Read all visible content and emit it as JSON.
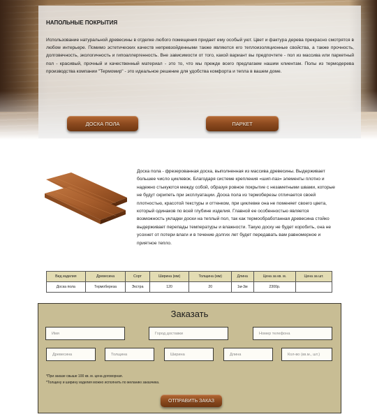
{
  "hero": {
    "title": "НАПОЛЬНЫЕ ПОКРЫТИЯ",
    "text": "Использование натуральной древесины в отделке любого помещения придает ему особый уют. Цвет и фактура дерева прекрасно смотрятся в любом интерьере. Помимо эстетических качеств непревзойденными также являются его теплоизоляционные свойства, а также прочность, долговечность, экологичность и гипоаллергенность. Вне зависимости от того, какой вариант вы предпочтете - пол из массива или паркетный пол - красивый, прочный и качественный материал - это то, что мы прежде всего предлагаем нашим клиентам. Полы из термодерева производства компании \"Термомир\" - это идеальное решение для удобства комфорта и тепла в вашем доме."
  },
  "buttons": {
    "floor_board": "ДОСКА ПОЛА",
    "parquet": "ПАРКЕТ",
    "order_submit": "ОТПРАВИТЬ ЗАКАЗ"
  },
  "product": {
    "image_icon": "wood-plank-image",
    "description": "Доска пола - фрезерованная доска, выполненная из массива древесины. Выдерживает большее число циклевок. Благодаря системе крепления «шип-паз» элементы плотно и надежно стыкуются между собой, образуя ровное покрытие с незаметными швами, которые не будут скрипеть при эксплуатации. Доска пола из термоберезы отличается своей плотностью, красотой текстуры и оттенком, при циклевке она не поменяет своего цвета, который одинаков по всей глубине изделия. Главной ее особенностью является возможность укладки доски на теплый пол, так как термообработанная древесина стойко выдерживает перепады температуры и влажности. Такую доску не будет коробить, она не усохнет от потери влаги и в течение долгих лет будет передавать вам равномерное и приятное тепло."
  },
  "table": {
    "headers": [
      "Вид изделия",
      "Древесина",
      "Сорт",
      "Ширина (мм)",
      "Толщина (мм)",
      "Длина",
      "Цена за кв. м.",
      "Цена за шт."
    ],
    "row": [
      "Доска пола",
      "Термобереза",
      "Экстра",
      "120",
      "20",
      "1м-3м",
      "2300р.",
      ""
    ]
  },
  "order": {
    "title": "Заказать",
    "placeholders": {
      "name": "Имя",
      "city": "Город доставки",
      "phone": "Номер телефона",
      "wood": "Древесина",
      "thickness": "Толщина",
      "width": "Ширина",
      "length": "Длина",
      "qty": "Кол-во (кв.м., шт.)"
    },
    "note1": "*При заказе свыше 100 кв. м. цена договорная.",
    "note2": "*Толщину и ширину изделия можно исполнить по желанию заказчика."
  },
  "colors": {
    "wood_button": "#8c4a1f",
    "form_bg": "#c8bd94",
    "table_header": "#e3dcb3"
  }
}
